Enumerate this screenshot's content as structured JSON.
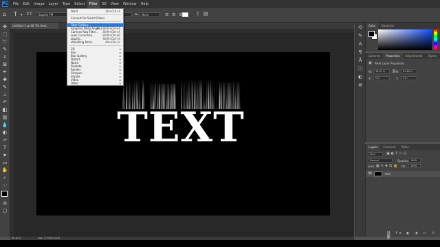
{
  "app": {
    "logo": "Ps"
  },
  "menubar": {
    "items": [
      "File",
      "Edit",
      "Image",
      "Layer",
      "Type",
      "Select",
      "Filter",
      "3D",
      "View",
      "Window",
      "Help"
    ],
    "active_index": 6
  },
  "options": {
    "font_family": "Gagalin FM",
    "font_style": "Regular",
    "font_size": "None",
    "mode": "None",
    "color": "#ffffff"
  },
  "document": {
    "tab_title": "Untitled-1 @ 66.7% (text, RGB/8#) *"
  },
  "status": {
    "zoom": "66.67%",
    "doc_info": "Doc: 5.93M/3.42M"
  },
  "canvas_text": "TEXT",
  "filter_menu": {
    "top": [
      {
        "label": "Wind",
        "shortcut": "Alt+Ctrl+F"
      }
    ],
    "middle": [
      {
        "label": "Convert for Smart Filters",
        "shortcut": ""
      }
    ],
    "gallery": [
      {
        "label": "Filter Gallery...",
        "shortcut": "",
        "highlighted": true
      },
      {
        "label": "Adaptive Wide Angle...",
        "shortcut": "Alt+Shift+Ctrl+A"
      },
      {
        "label": "Camera Raw Filter...",
        "shortcut": "Shift+Ctrl+A"
      },
      {
        "label": "Lens Correction...",
        "shortcut": "Shift+Ctrl+R"
      },
      {
        "label": "Liquify...",
        "shortcut": "Shift+Ctrl+X"
      },
      {
        "label": "Vanishing Point...",
        "shortcut": "Alt+Ctrl+V"
      }
    ],
    "submenus": [
      "3D",
      "Blur",
      "Blur Gallery",
      "Distort",
      "Noise",
      "Pixelate",
      "Render",
      "Sharpen",
      "Stylize",
      "Video",
      "Other"
    ]
  },
  "color_panel": {
    "tabs": [
      "Color",
      "Swatches"
    ],
    "foreground": "#000000",
    "background": "#ffffff"
  },
  "properties_panel": {
    "tabs": [
      "Libraries",
      "Properties",
      "Adjustments",
      "Styles"
    ],
    "active_tab": 1,
    "section_title": "Pixel Layer Properties",
    "w_label": "W:",
    "w_value": "36.67 in",
    "h_label": "H:",
    "h_value": "20.83 in",
    "x_label": "X:",
    "x_value": "0 in",
    "y_label": "Y:",
    "y_value": "0 in",
    "go_label": "GO"
  },
  "layers_panel": {
    "tabs": [
      "Layers",
      "Channels",
      "Paths"
    ],
    "kind_label": "Kind",
    "blend_mode": "Normal",
    "opacity_label": "Opacity:",
    "opacity": "100%",
    "lock_label": "Lock:",
    "fill_label": "Fill:",
    "fill": "100%",
    "layer_name": "text"
  }
}
